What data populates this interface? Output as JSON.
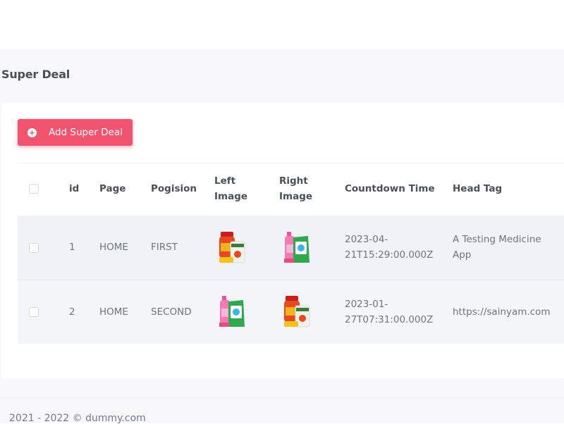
{
  "page": {
    "title": "Super Deal"
  },
  "toolbar": {
    "add_label": "Add Super Deal",
    "add_icon": "plus-circle-icon"
  },
  "table": {
    "headers": {
      "id": "id",
      "page": "Page",
      "position_line1": "Pogision",
      "left_image_line1": "Left",
      "left_image_line2": "Image",
      "right_image_line1": "Right",
      "right_image_line2": "Image",
      "countdown": "Countdown Time",
      "head_tag": "Head Tag"
    },
    "rows": [
      {
        "id": "1",
        "page": "HOME",
        "position": "FIRST",
        "left_image": "honey-jar-product-image",
        "right_image": "handwash-pack-product-image",
        "countdown_line1": "2023-04-",
        "countdown_line2": "21T15:29:00.000Z",
        "head_tag_line1": "A Testing Medicine",
        "head_tag_line2": "App"
      },
      {
        "id": "2",
        "page": "HOME",
        "position": "SECOND",
        "left_image": "handwash-pack-product-image",
        "right_image": "honey-jar-product-image",
        "countdown_line1": "2023-01-",
        "countdown_line2": "27T07:31:00.000Z",
        "head_tag_line1": "https://sainyam.com",
        "head_tag_line2": ""
      }
    ]
  },
  "footer": {
    "text": "2021 - 2022 © dummy.com"
  },
  "colors": {
    "accent": "#f1546e",
    "row_bg": "#f0f2f7",
    "page_bg": "#f8f8fb"
  }
}
